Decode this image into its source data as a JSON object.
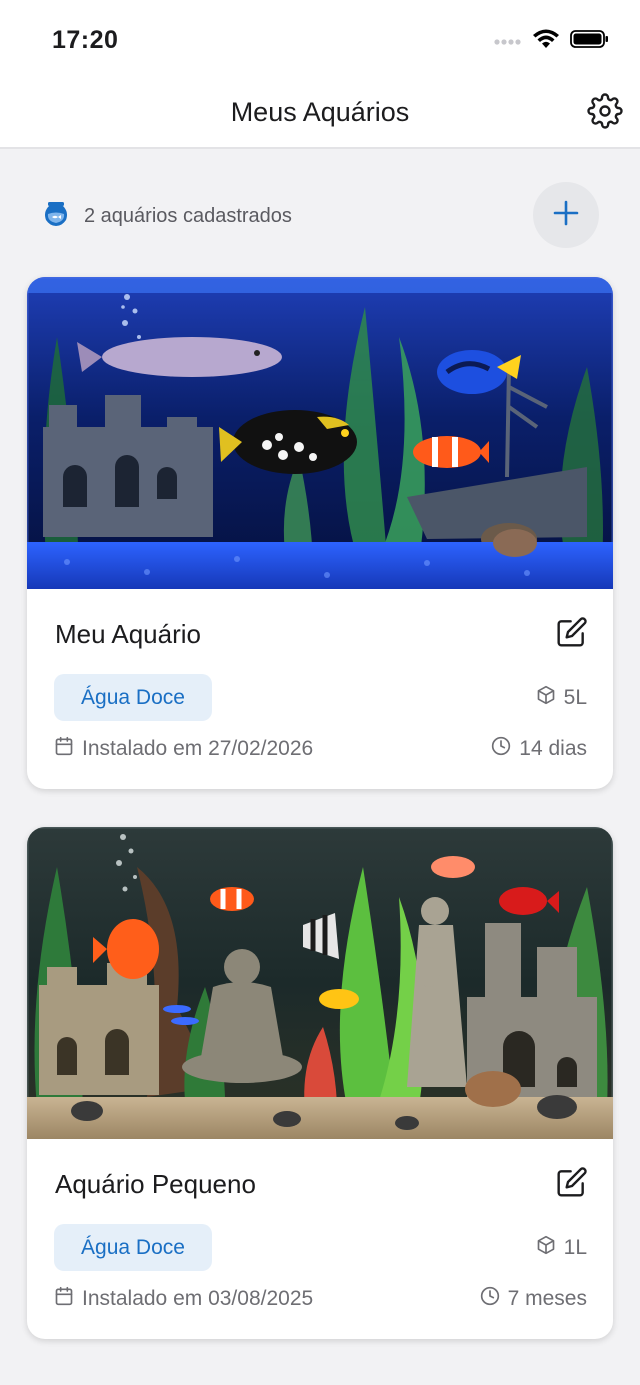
{
  "status_bar": {
    "time": "17:20"
  },
  "header": {
    "title": "Meus Aquários",
    "settings_icon": "gear-icon"
  },
  "summary": {
    "text": "2 aquários cadastrados",
    "icon": "fishbowl-icon",
    "add_icon": "plus-icon"
  },
  "colors": {
    "accent": "#1a6fc4",
    "badge_bg": "#e5eff9"
  },
  "aquariums": [
    {
      "name": "Meu Aquário",
      "type": "Água Doce",
      "volume": "5L",
      "installed": "Instalado em 27/02/2026",
      "age": "14 dias",
      "image": "blue-lit aquarium with arowana, triggerfish, blue tang, clownfish, castle ruin and shipwreck"
    },
    {
      "name": "Aquário Pequeno",
      "type": "Água Doce",
      "volume": "1L",
      "installed": "Instalado em 03/08/2025",
      "age": "7 meses",
      "image": "planted aquarium with discus, angelfish, buddha statue, greek statue and castle ruins"
    }
  ]
}
